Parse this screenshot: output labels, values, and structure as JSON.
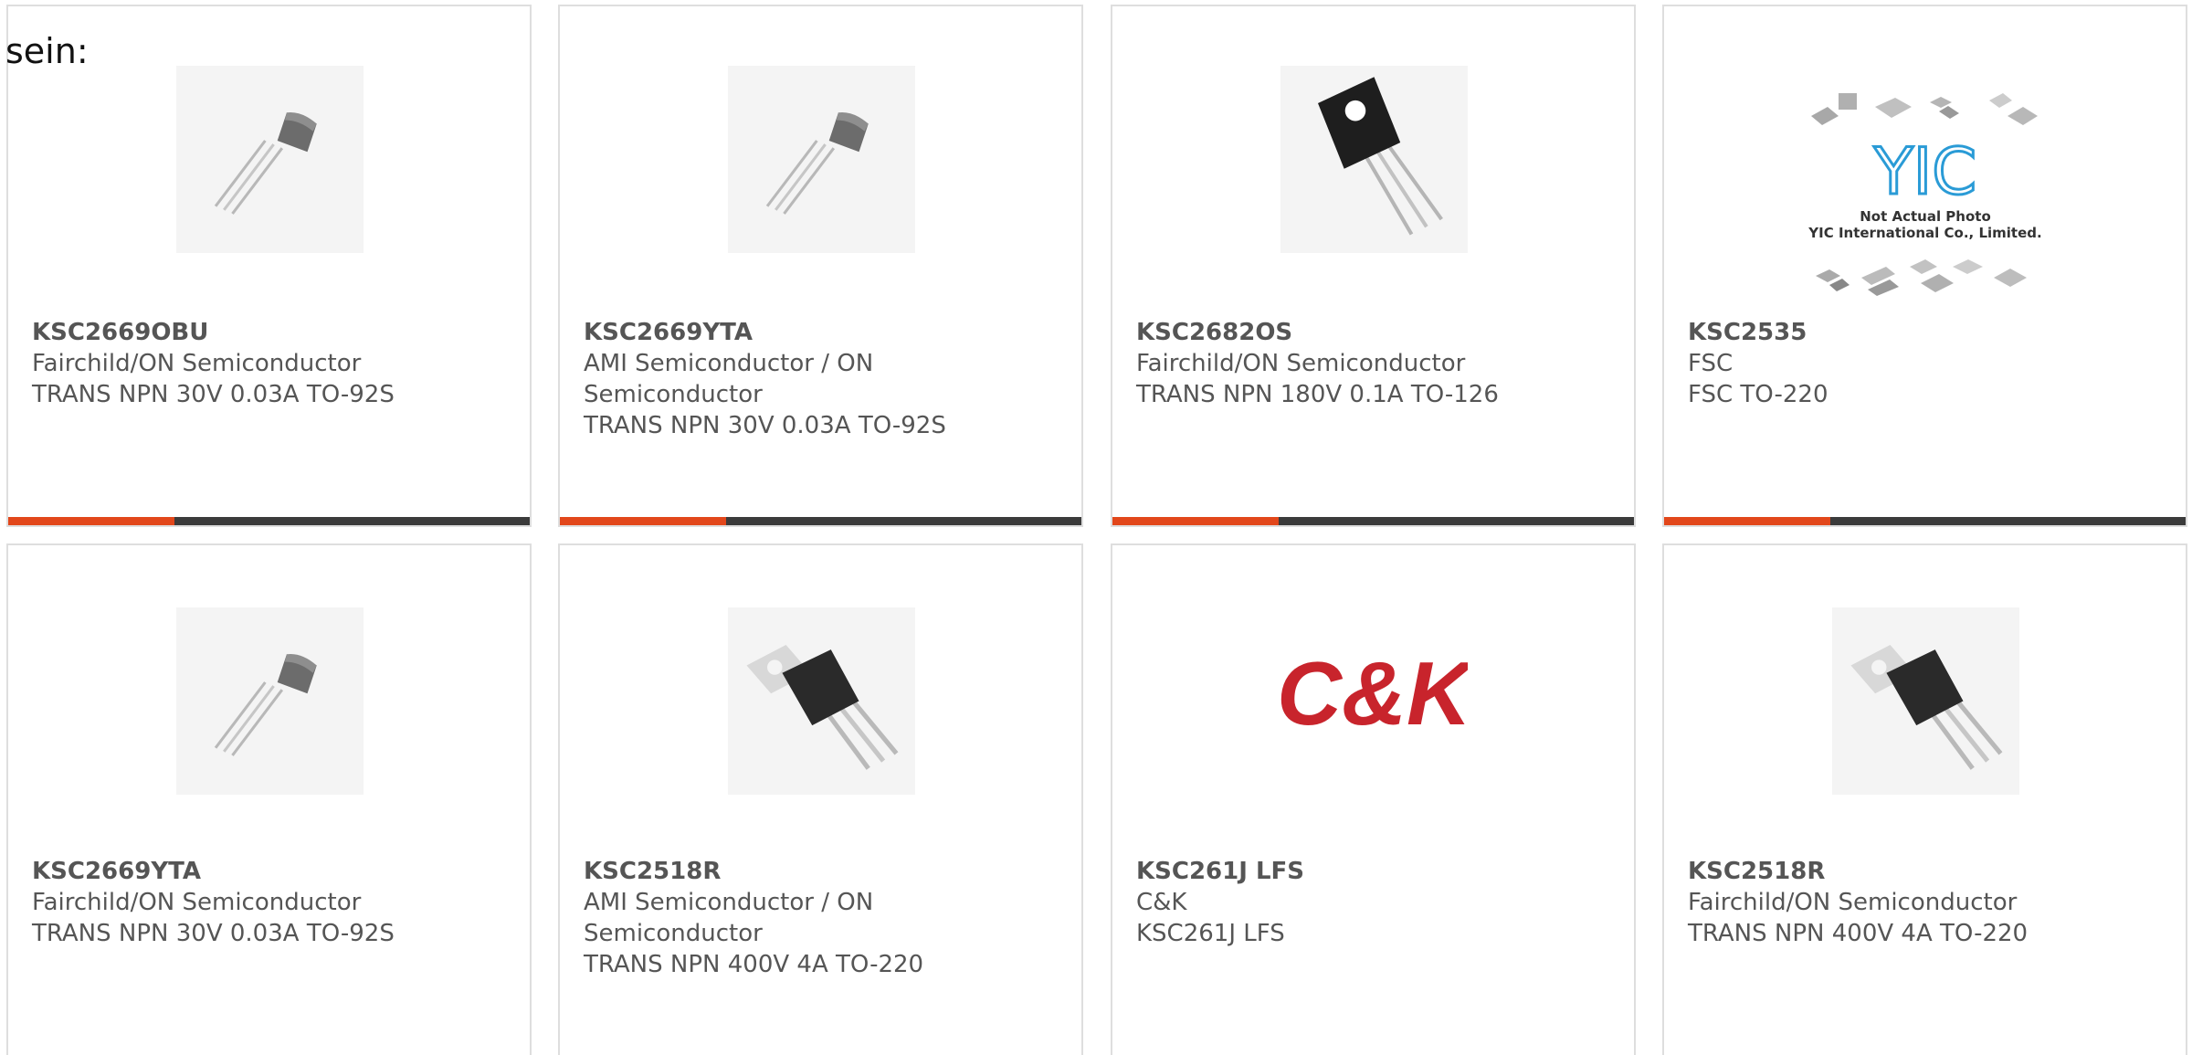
{
  "intro_text": "sein:",
  "colors": {
    "accent": "#e2471b",
    "bar_dark": "#3b3b3b",
    "ck_red": "#c8242c"
  },
  "products": [
    {
      "part": "KSC2669OBU",
      "lines": [
        "Fairchild/ON Semiconductor",
        "TRANS NPN 30V 0.03A TO-92S"
      ],
      "image": "to92-transistor"
    },
    {
      "part": "KSC2669YTA",
      "lines": [
        "AMI Semiconductor / ON",
        "Semiconductor",
        "TRANS NPN 30V 0.03A TO-92S"
      ],
      "image": "to92-transistor"
    },
    {
      "part": "KSC2682OS",
      "lines": [
        "Fairchild/ON Semiconductor",
        "TRANS NPN 180V 0.1A TO-126"
      ],
      "image": "to126-transistor"
    },
    {
      "part": "KSC2535",
      "lines": [
        "FSC",
        "FSC TO-220"
      ],
      "image": "yic-placeholder",
      "image_text": [
        "YIC",
        "Not Actual Photo",
        "YIC International Co., Limited."
      ]
    },
    {
      "part": "KSC2669YTA",
      "lines": [
        "Fairchild/ON Semiconductor",
        "TRANS NPN 30V 0.03A TO-92S"
      ],
      "image": "to92-transistor"
    },
    {
      "part": "KSC2518R",
      "lines": [
        "AMI Semiconductor / ON",
        "Semiconductor",
        "TRANS NPN 400V 4A TO-220"
      ],
      "image": "to220-transistor"
    },
    {
      "part": "KSC261J LFS",
      "lines": [
        "C&K",
        "KSC261J LFS"
      ],
      "image": "ck-logo",
      "image_text": [
        "C&K"
      ]
    },
    {
      "part": "KSC2518R",
      "lines": [
        "Fairchild/ON Semiconductor",
        "TRANS NPN 400V 4A TO-220"
      ],
      "image": "to220-transistor"
    }
  ]
}
